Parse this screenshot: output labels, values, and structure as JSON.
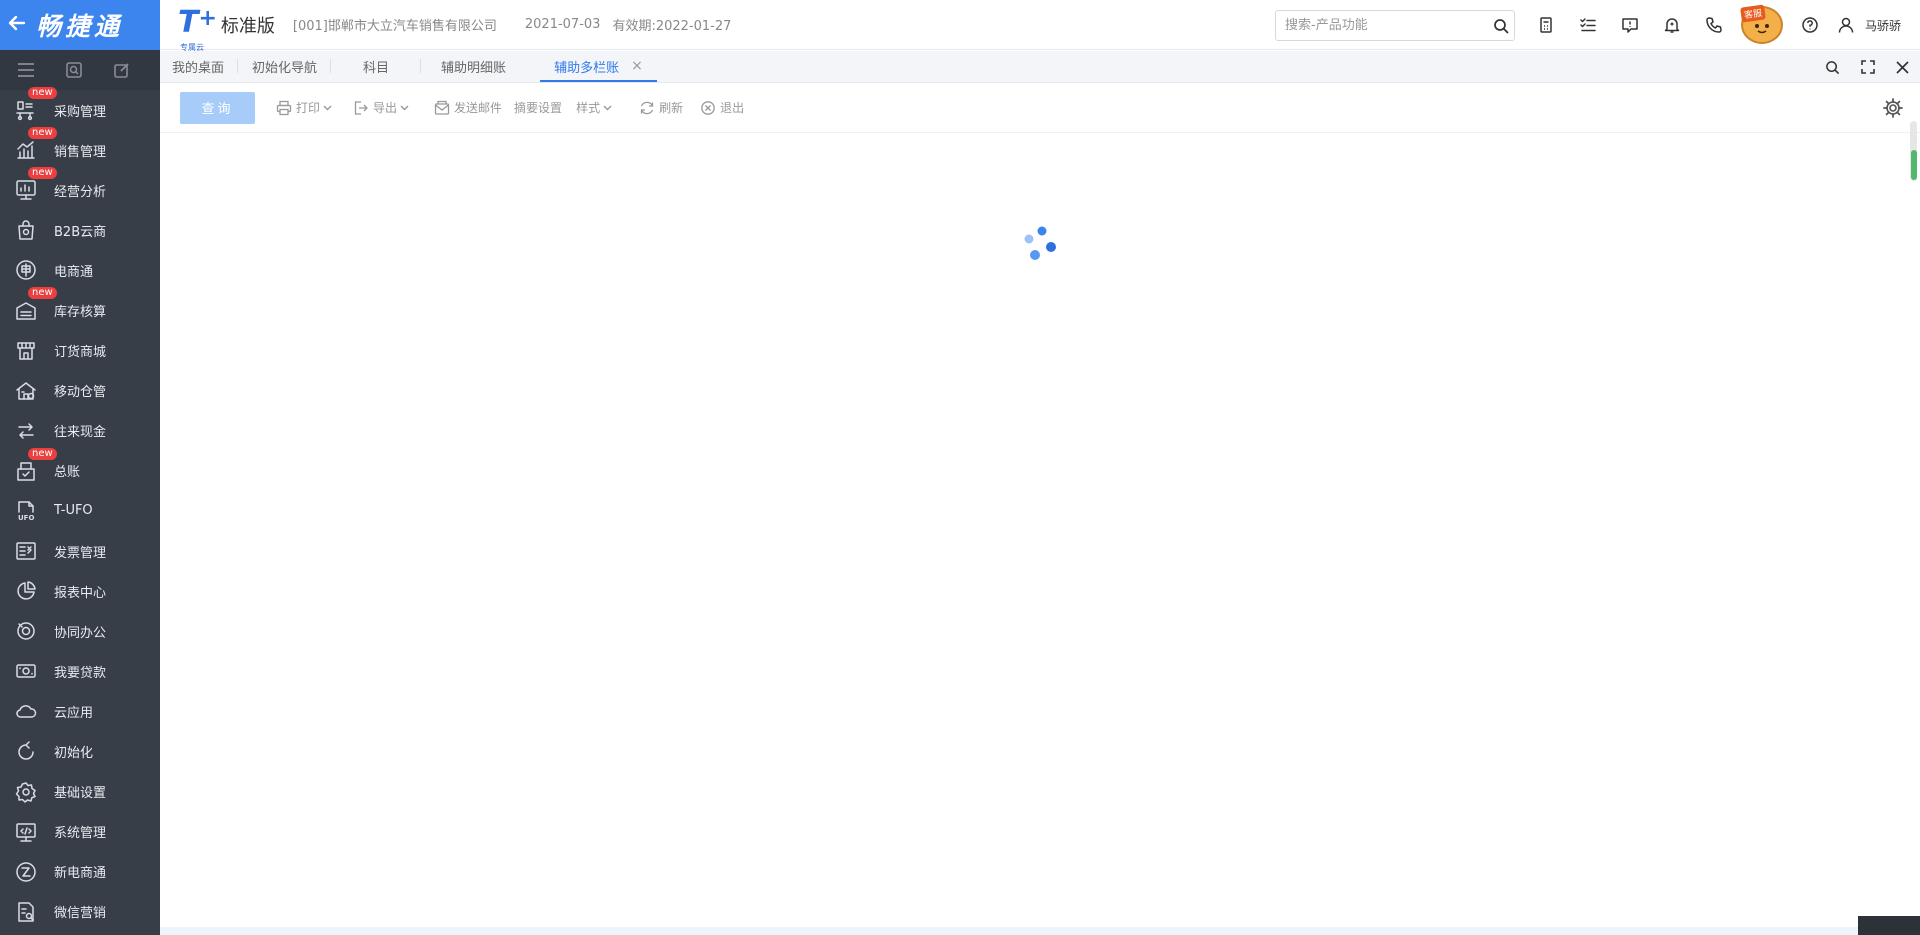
{
  "brand": {
    "back_icon": "arrow-left-icon",
    "name": "畅捷通"
  },
  "header": {
    "logo_main": "T",
    "logo_plus": "+",
    "logo_sub": "专属云",
    "edition": "标准版",
    "company": "[001]邯郸市大立汽车销售有限公司",
    "date": "2021-07-03",
    "expiry": "有效期:2022-01-27",
    "search_placeholder": "搜索-产品功能",
    "mascot_tag": "客服",
    "user_name": "马骄骄",
    "icons": [
      "calculator-icon",
      "checklist-icon",
      "message-icon",
      "bell-icon",
      "phone-icon",
      "help-icon",
      "user-icon"
    ]
  },
  "sidebar": {
    "tools": [
      "menu-icon",
      "search-doc-icon",
      "edit-icon"
    ],
    "badge_text": "new",
    "items": [
      {
        "label": "采购管理",
        "icon": "purchase-icon",
        "badge": true
      },
      {
        "label": "销售管理",
        "icon": "sales-chart-icon",
        "badge": true
      },
      {
        "label": "经营分析",
        "icon": "analysis-icon",
        "badge": true
      },
      {
        "label": "B2B云商",
        "icon": "b2b-bag-icon",
        "badge": false
      },
      {
        "label": "电商通",
        "icon": "ecommerce-icon",
        "badge": false
      },
      {
        "label": "库存核算",
        "icon": "inventory-icon",
        "badge": true
      },
      {
        "label": "订货商城",
        "icon": "store-icon",
        "badge": false
      },
      {
        "label": "移动仓管",
        "icon": "warehouse-icon",
        "badge": false
      },
      {
        "label": "往来现金",
        "icon": "exchange-icon",
        "badge": false
      },
      {
        "label": "总账",
        "icon": "ledger-icon",
        "badge": true
      },
      {
        "label": "T-UFO",
        "icon": "ufo-doc-icon",
        "badge": false
      },
      {
        "label": "发票管理",
        "icon": "invoice-icon",
        "badge": false
      },
      {
        "label": "报表中心",
        "icon": "pie-chart-icon",
        "badge": false
      },
      {
        "label": "协同办公",
        "icon": "collab-icon",
        "badge": false
      },
      {
        "label": "我要贷款",
        "icon": "money-icon",
        "badge": false
      },
      {
        "label": "云应用",
        "icon": "cloud-icon",
        "badge": false
      },
      {
        "label": "初始化",
        "icon": "refresh-icon",
        "badge": false
      },
      {
        "label": "基础设置",
        "icon": "gear-icon",
        "badge": false
      },
      {
        "label": "系统管理",
        "icon": "monitor-code-icon",
        "badge": false
      },
      {
        "label": "新电商通",
        "icon": "new-ecommerce-icon",
        "badge": false
      },
      {
        "label": "微信营销",
        "icon": "wechat-doc-icon",
        "badge": false
      }
    ]
  },
  "tabs": [
    {
      "label": "我的桌面",
      "active": false
    },
    {
      "label": "初始化导航",
      "active": false
    },
    {
      "label": "科目",
      "active": false
    },
    {
      "label": "辅助明细账",
      "active": false
    },
    {
      "label": "辅助多栏账",
      "active": true
    }
  ],
  "tab_close": "×",
  "tab_tools": [
    "search-icon",
    "fullscreen-icon",
    "close-icon"
  ],
  "toolbar": {
    "query": "查询",
    "print": "打印",
    "export": "导出",
    "send_mail": "发送邮件",
    "summary_settings": "摘要设置",
    "style": "样式",
    "refresh": "刷新",
    "exit": "退出"
  },
  "colors": {
    "brand_blue": "#3c84ee",
    "sidebar_bg": "#373e48",
    "accent": "#2f7bed",
    "badge_red": "#ec3f3f",
    "query_button": "#a7ccf9"
  }
}
